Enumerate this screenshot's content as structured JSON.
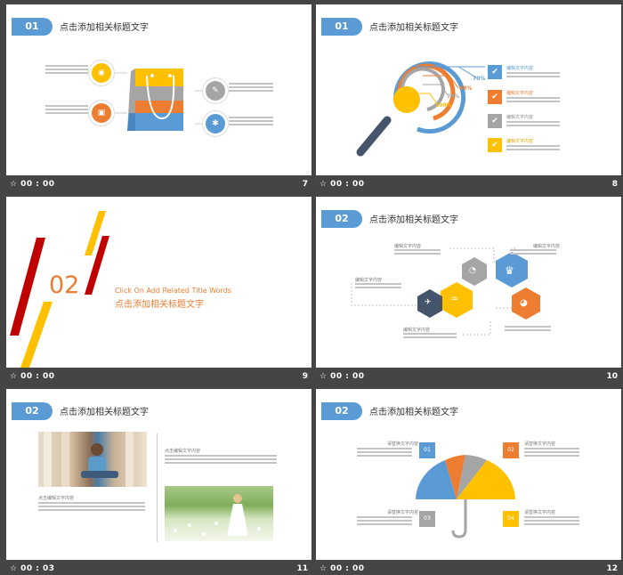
{
  "slides": [
    {
      "tag": "01",
      "title": "点击添加相关标题文字",
      "time": "00 : 00",
      "num": "7"
    },
    {
      "tag": "01",
      "title": "点击添加相关标题文字",
      "time": "00 : 00",
      "num": "8",
      "percents": [
        "70%",
        "88%",
        "79%",
        "100%"
      ],
      "checklist": [
        "编辑文字内容",
        "编辑文字内容",
        "编辑文字内容",
        "编辑文字内容"
      ]
    },
    {
      "time": "00 : 00",
      "num": "9",
      "section_number": "02",
      "section_en": "Click On Add Related Title Words",
      "section_cn": "点击添加相关标题文字"
    },
    {
      "tag": "02",
      "title": "点击添加相关标题文字",
      "time": "00 : 00",
      "num": "10",
      "labels": [
        "编辑文字内容",
        "编辑文字内容",
        "编辑文字内容",
        "编辑文字内容"
      ]
    },
    {
      "tag": "02",
      "title": "点击添加相关标题文字",
      "time": "00 : 03",
      "num": "11",
      "captions": [
        "点击编辑文字内容",
        "点击编辑文字内容"
      ]
    },
    {
      "tag": "02",
      "title": "点击添加相关标题文字",
      "time": "00 : 00",
      "num": "12",
      "labels": [
        "请替换文字内容",
        "请替换文字内容",
        "请替换文字内容",
        "请替换文字内容"
      ],
      "badges": [
        "01",
        "02",
        "03",
        "04"
      ]
    }
  ],
  "colors": {
    "blue": "#5b9bd5",
    "orange": "#ed7d31",
    "yellow": "#ffc000",
    "gray": "#a5a5a5",
    "dark": "#44546a",
    "red": "#c00000"
  },
  "icons": [
    "eye-icon",
    "lock-icon",
    "wrench-icon",
    "gear-icon",
    "magnifier-icon",
    "check-icon",
    "trophy-icon",
    "pie-icon",
    "rocket-icon",
    "chart-icon",
    "umbrella-icon",
    "transition-icon"
  ]
}
